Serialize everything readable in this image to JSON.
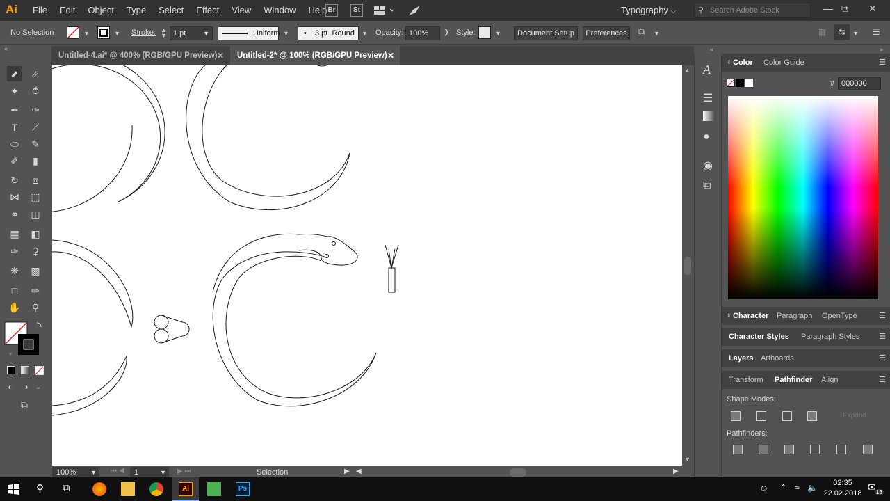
{
  "app": {
    "logo": "Ai"
  },
  "menu": [
    "File",
    "Edit",
    "Object",
    "Type",
    "Select",
    "Effect",
    "View",
    "Window",
    "Help"
  ],
  "app_buttons": [
    "Br",
    "St"
  ],
  "workspace": "Typography",
  "search_placeholder": "Search Adobe Stock",
  "control": {
    "selection": "No Selection",
    "stroke_label": "Stroke:",
    "stroke_weight": "1 pt",
    "profile": "Uniform",
    "brush": "3 pt. Round",
    "opacity_label": "Opacity:",
    "opacity": "100%",
    "style_label": "Style:",
    "doc_setup": "Document Setup",
    "preferences": "Preferences"
  },
  "tabs": [
    {
      "label": "Untitled-4.ai* @ 400% (RGB/GPU Preview)",
      "active": false
    },
    {
      "label": "Untitled-2* @ 100% (RGB/GPU Preview)",
      "active": true
    }
  ],
  "status": {
    "zoom": "100%",
    "artboard": "1",
    "tool": "Selection"
  },
  "color_panel": {
    "tabs": [
      "Color",
      "Color Guide"
    ],
    "hex_label": "#",
    "hex": "000000"
  },
  "char_panel": {
    "tabs": [
      "Character",
      "Paragraph",
      "OpenType"
    ]
  },
  "styles_panel": {
    "tabs": [
      "Character Styles",
      "Paragraph Styles"
    ]
  },
  "layers_panel": {
    "tabs": [
      "Layers",
      "Artboards"
    ]
  },
  "pathfinder_panel": {
    "tabs": [
      "Transform",
      "Pathfinder",
      "Align"
    ],
    "shape_modes": "Shape Modes:",
    "expand": "Expand",
    "pathfinders": "Pathfinders:"
  },
  "taskbar": {
    "time": "02:35",
    "date": "22.02.2018",
    "notifications": "13"
  },
  "colors": {
    "accent": "#ff9a00",
    "chrome_dark": "#323232",
    "panel": "#535353"
  }
}
